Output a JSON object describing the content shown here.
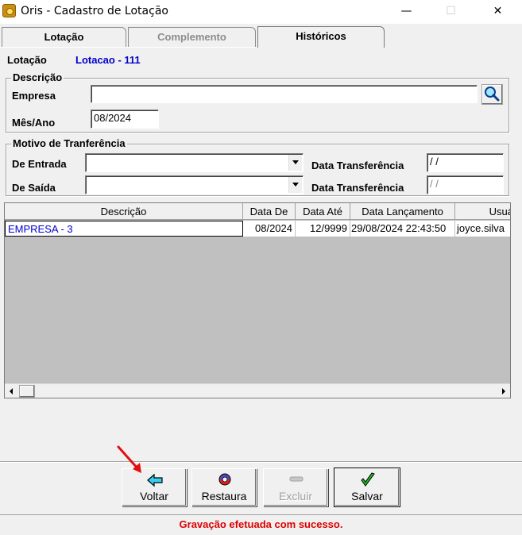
{
  "window": {
    "title": "Oris - Cadastro de Lotação",
    "minimize": "—",
    "maximize": "☐",
    "close": "✕"
  },
  "tabs": [
    {
      "label": "Lotação",
      "state": "inactive"
    },
    {
      "label": "Complemento",
      "state": "disabled"
    },
    {
      "label": "Históricos",
      "state": "active"
    }
  ],
  "lotacao": {
    "label": "Lotação",
    "value": "Lotacao - 111"
  },
  "descricao_group": {
    "title": "Descrição",
    "empresa_label": "Empresa",
    "empresa_value": "",
    "mes_ano_label": "Mês/Ano",
    "mes_ano_value": "08/2024"
  },
  "motivo_group": {
    "title": "Motivo de Tranferência",
    "entrada_label": "De Entrada",
    "entrada_value": "",
    "saida_label": "De Saída",
    "saida_value": "",
    "data_transf_label_1": "Data Transferência",
    "data_transf_value_1": " / /",
    "data_transf_label_2": "Data Transferência",
    "data_transf_value_2": " / /"
  },
  "grid": {
    "columns": [
      "Descrição",
      "Data De",
      "Data Até",
      "Data Lançamento",
      "Usuá"
    ],
    "rows": [
      [
        "EMPRESA - 3",
        "08/2024",
        "12/9999",
        "29/08/2024 22:43:50",
        "joyce.silva"
      ]
    ]
  },
  "buttons": {
    "voltar": "Voltar",
    "restaura": "Restaura",
    "excluir": "Excluir",
    "salvar": "Salvar"
  },
  "status": {
    "message": "Gravação efetuada com sucesso.",
    "color": "#e00000"
  },
  "icons": {
    "search": "magnifier-icon",
    "voltar": "arrow-left-icon",
    "restaura": "restore-icon",
    "excluir": "delete-icon",
    "salvar": "checkmark-icon"
  }
}
